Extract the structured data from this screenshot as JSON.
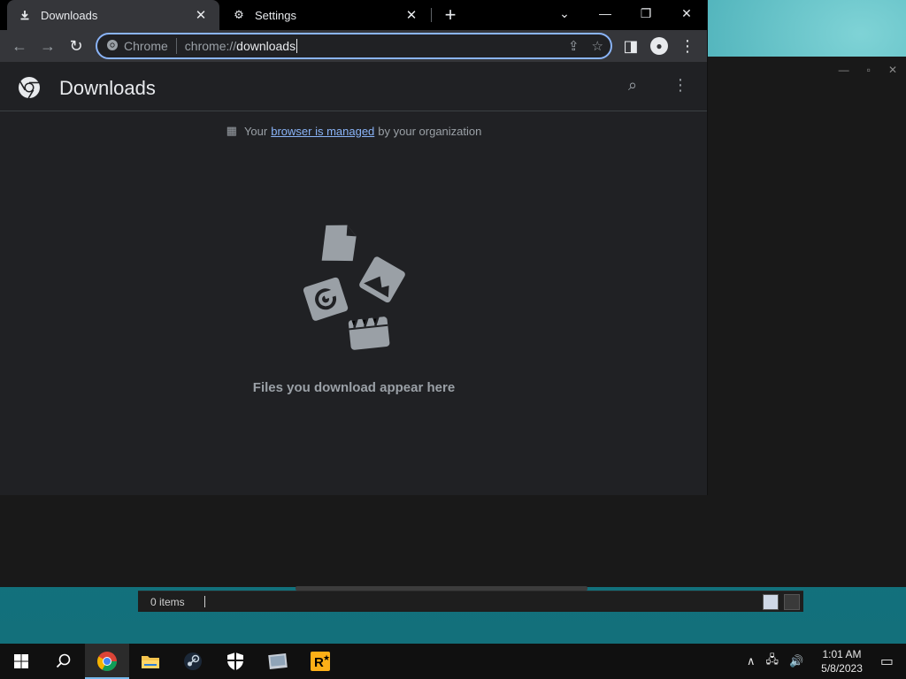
{
  "tabs": [
    {
      "label": "Downloads",
      "icon": "download-icon",
      "active": true
    },
    {
      "label": "Settings",
      "icon": "gear-icon",
      "active": false
    }
  ],
  "omnibox": {
    "site_label": "Chrome",
    "url_prefix": "chrome://",
    "url_host": "downloads"
  },
  "page": {
    "title": "Downloads",
    "managed_prefix": "Your",
    "managed_link": "browser is managed",
    "managed_suffix": "by your organization",
    "empty_message": "Files you download appear here"
  },
  "explorer": {
    "status": "0 items"
  },
  "taskbar": {
    "apps": [
      "windows-start",
      "search",
      "chrome",
      "file-explorer",
      "steam",
      "security",
      "photo-app",
      "rockstar-launcher"
    ],
    "time": "1:01 AM",
    "date": "5/8/2023"
  },
  "colors": {
    "accent": "#8ab4f8",
    "page_bg": "#202124",
    "toolbar_bg": "#35363a"
  }
}
